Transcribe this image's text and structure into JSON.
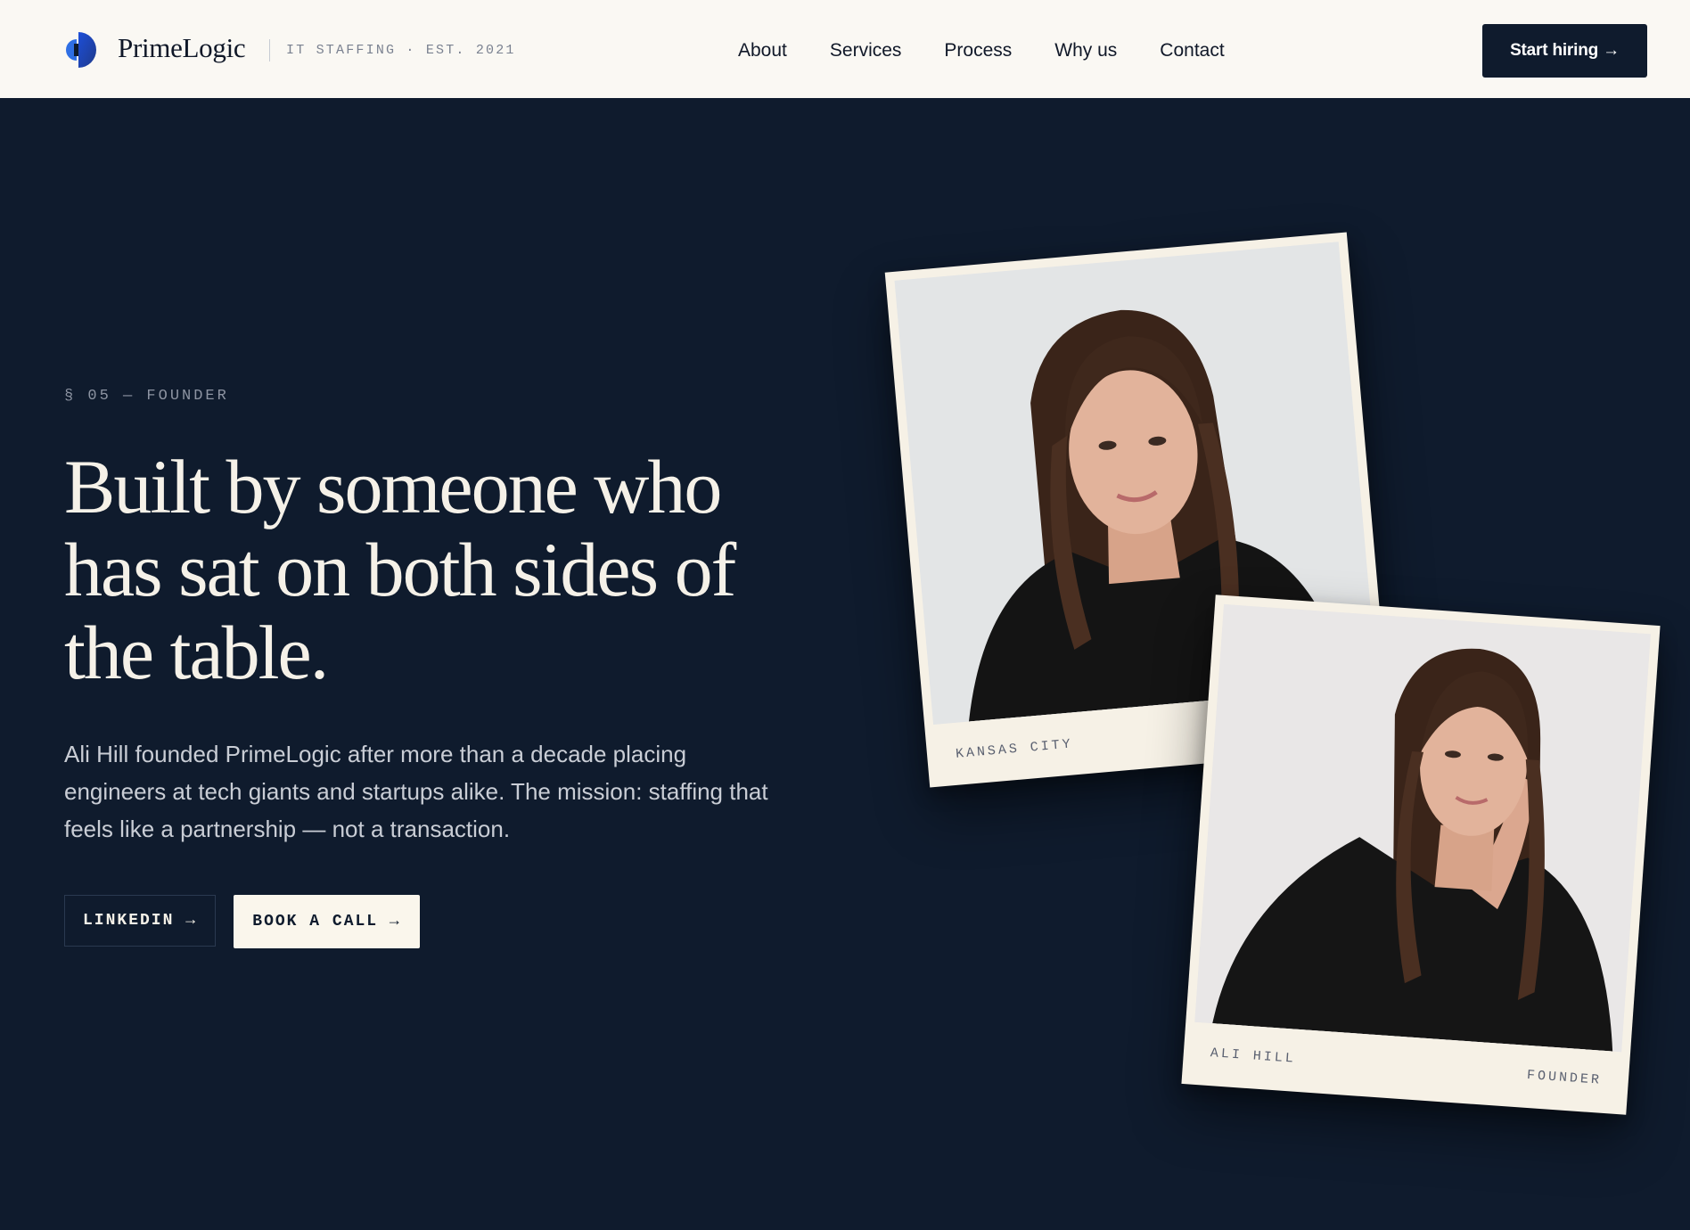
{
  "header": {
    "brand_name": "PrimeLogic",
    "brand_tagline": "IT STAFFING · EST. 2021",
    "nav": [
      {
        "label": "About"
      },
      {
        "label": "Services"
      },
      {
        "label": "Process"
      },
      {
        "label": "Why us"
      },
      {
        "label": "Contact"
      }
    ],
    "cta_label": "Start hiring →"
  },
  "hero": {
    "eyebrow": "§ 05 — FOUNDER",
    "headline": "Built by someone who has sat on both sides of the table.",
    "body": "Ali Hill founded PrimeLogic after more than a decade placing engineers at tech giants and startups alike. The mission: staffing that feels like a partnership — not a transaction.",
    "buttons": {
      "linkedin": "LINKEDIN →",
      "book_call": "BOOK A CALL →"
    }
  },
  "photos": [
    {
      "caption_left": "KANSAS CITY"
    },
    {
      "caption_left": "ALI HILL",
      "caption_right": "FOUNDER"
    }
  ],
  "icons": {
    "logo": "primelogic-logo-icon"
  },
  "colors": {
    "background": "#0f1b2d",
    "header_bg": "#faf8f3",
    "text_light": "#f5f1e8",
    "accent_blue": "#2563eb"
  }
}
